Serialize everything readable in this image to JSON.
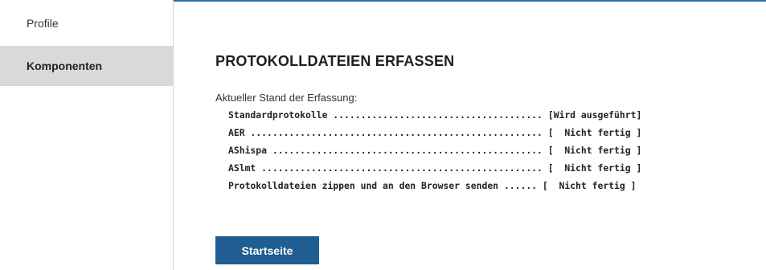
{
  "sidebar": {
    "items": [
      {
        "label": "Profile"
      },
      {
        "label": "Komponenten"
      }
    ]
  },
  "main": {
    "title": "PROTOKOLLDATEIEN ERFASSEN",
    "status_caption": "Aktueller Stand der Erfassung:",
    "status_lines": [
      "Standardprotokolle ...................................... [Wird ausgeführt]",
      "AER ..................................................... [  Nicht fertig ]",
      "AShispa ................................................. [  Nicht fertig ]",
      "ASlmt ................................................... [  Nicht fertig ]",
      "Protokolldateien zippen und an den Browser senden ...... [  Nicht fertig ]"
    ],
    "start_button_label": "Startseite"
  },
  "colors": {
    "accent": "#2a6fa8",
    "button": "#1f5d93",
    "active_sidebar": "#d9d9d9"
  }
}
